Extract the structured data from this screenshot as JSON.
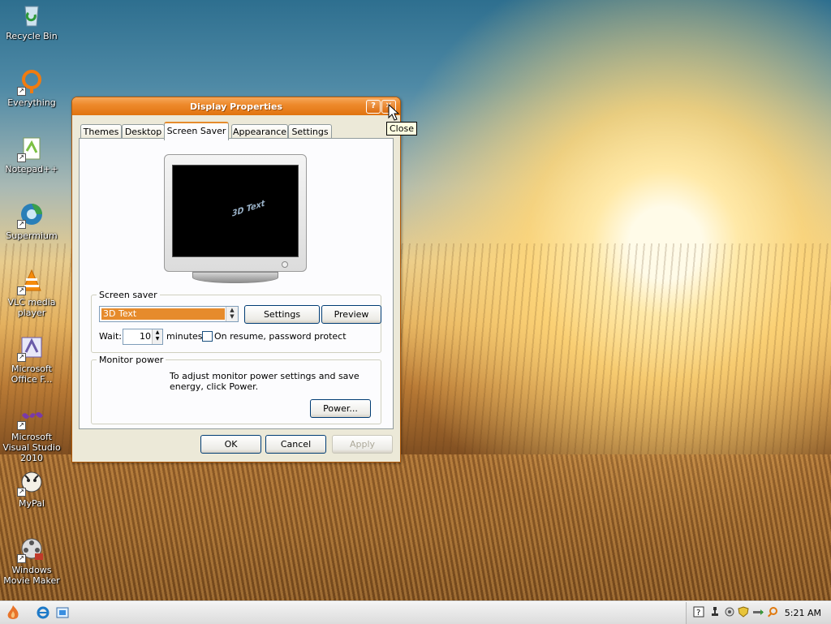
{
  "desktop": {
    "icons": [
      {
        "label": "Recycle Bin",
        "icon": "recycle-bin-icon"
      },
      {
        "label": "Everything",
        "icon": "everything-search-icon"
      },
      {
        "label": "Notepad++",
        "icon": "notepadpp-icon"
      },
      {
        "label": "Supermium",
        "icon": "supermium-browser-icon"
      },
      {
        "label": "VLC media player",
        "icon": "vlc-icon"
      },
      {
        "label": "Microsoft Office F...",
        "icon": "office-icon"
      },
      {
        "label": "Microsoft Visual Studio 2010",
        "icon": "visual-studio-icon"
      },
      {
        "label": "MyPal",
        "icon": "mypal-icon"
      },
      {
        "label": "Windows Movie Maker",
        "icon": "movie-maker-icon"
      }
    ]
  },
  "dialog": {
    "title": "Display Properties",
    "help_label": "?",
    "close_label": "✕",
    "tabs": [
      {
        "label": "Themes"
      },
      {
        "label": "Desktop"
      },
      {
        "label": "Screen Saver",
        "active": true
      },
      {
        "label": "Appearance"
      },
      {
        "label": "Settings"
      }
    ],
    "preview_text": "3D Text",
    "screensaver_group": {
      "legend": "Screen saver",
      "selected": "3D Text",
      "settings_label": "Settings",
      "preview_label": "Preview",
      "wait_label": "Wait:",
      "wait_value": "10",
      "minutes_label": "minutes",
      "password_label": "On resume, password protect",
      "password_checked": false
    },
    "monitor_group": {
      "legend": "Monitor power",
      "description": "To adjust monitor power settings and save energy, click Power.",
      "power_label": "Power..."
    },
    "buttons": {
      "ok": "OK",
      "cancel": "Cancel",
      "apply": "Apply"
    }
  },
  "tooltip": "Close",
  "taskbar": {
    "clock": "5:21 AM"
  }
}
